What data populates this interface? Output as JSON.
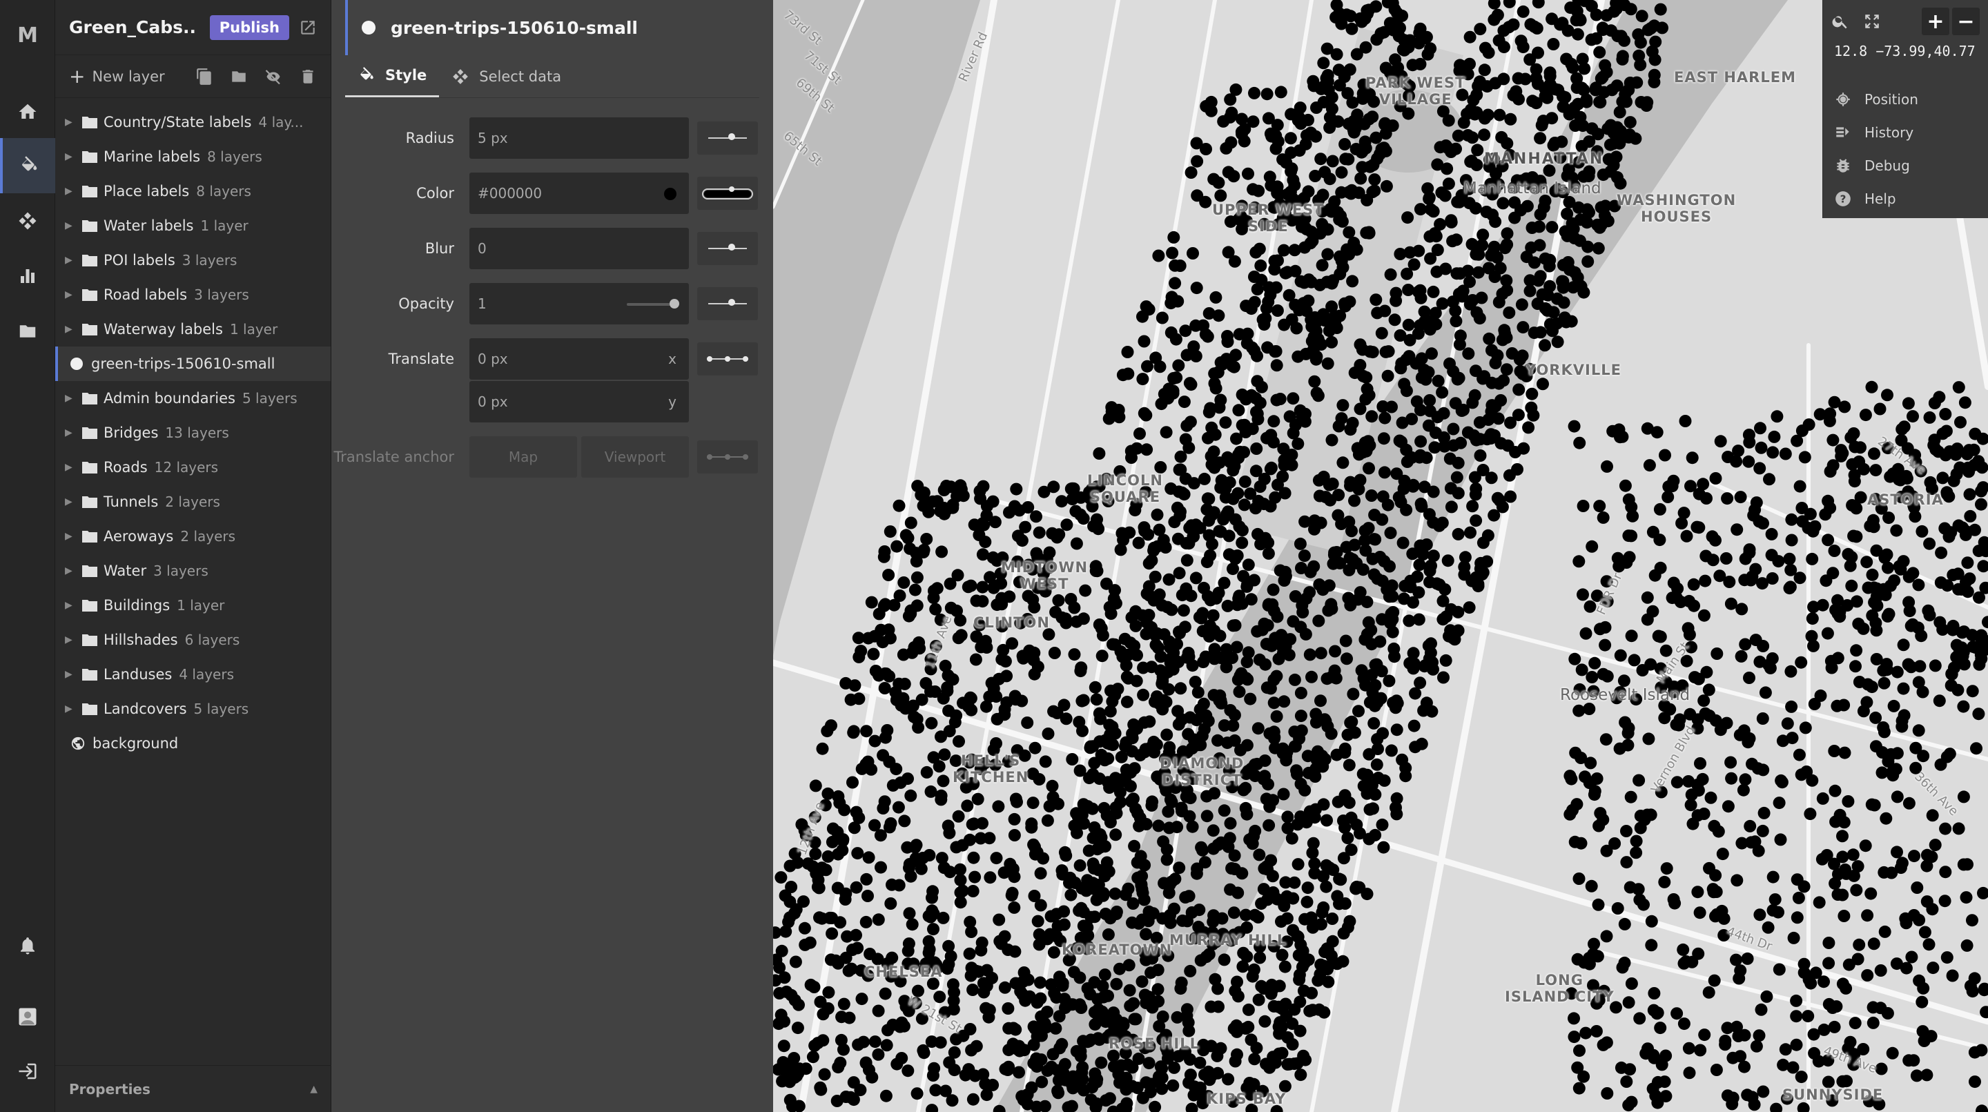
{
  "rail": {
    "logo": "M"
  },
  "project": {
    "title": "Green_Cabs...",
    "publish_label": "Publish"
  },
  "layers_panel": {
    "new_layer_label": "New layer",
    "items": [
      {
        "name": "Country/State labels",
        "count": "4 lay..."
      },
      {
        "name": "Marine labels",
        "count": "8 layers"
      },
      {
        "name": "Place labels",
        "count": "8 layers"
      },
      {
        "name": "Water labels",
        "count": "1 layer"
      },
      {
        "name": "POI labels",
        "count": "3 layers"
      },
      {
        "name": "Road labels",
        "count": "3 layers"
      },
      {
        "name": "Waterway labels",
        "count": "1 layer"
      },
      {
        "name": "green-trips-150610-small",
        "count": ""
      },
      {
        "name": "Admin boundaries",
        "count": "5 layers"
      },
      {
        "name": "Bridges",
        "count": "13 layers"
      },
      {
        "name": "Roads",
        "count": "12 layers"
      },
      {
        "name": "Tunnels",
        "count": "2 layers"
      },
      {
        "name": "Aeroways",
        "count": "2 layers"
      },
      {
        "name": "Water",
        "count": "3 layers"
      },
      {
        "name": "Buildings",
        "count": "1 layer"
      },
      {
        "name": "Hillshades",
        "count": "6 layers"
      },
      {
        "name": "Landuses",
        "count": "4 layers"
      },
      {
        "name": "Landcovers",
        "count": "5 layers"
      },
      {
        "name": "background",
        "count": ""
      }
    ],
    "properties_label": "Properties"
  },
  "editor": {
    "layer_title": "green-trips-150610-small",
    "tabs": {
      "style": "Style",
      "select_data": "Select data"
    },
    "radius": {
      "label": "Radius",
      "value": "5 px"
    },
    "color": {
      "label": "Color",
      "value": "#000000",
      "swatch": "#000000"
    },
    "blur": {
      "label": "Blur",
      "value": "0"
    },
    "opacity": {
      "label": "Opacity",
      "value": "1",
      "level": 1
    },
    "translate": {
      "label": "Translate",
      "x_value": "0 px",
      "x_axis": "x",
      "y_value": "0 px",
      "y_axis": "y"
    },
    "translate_anchor": {
      "label": "Translate anchor",
      "opt_map": "Map",
      "opt_viewport": "Viewport"
    }
  },
  "map": {
    "labels": {
      "manhattan": "MANHATTAN",
      "manhattan_island": "Manhattan Island",
      "park_west_village": "PARK WEST\nVILLAGE",
      "east_harlem": "EAST HARLEM",
      "washington_houses": "WASHINGTON\nHOUSES",
      "upper_west_side": "UPPER WEST\nSIDE",
      "yorkville": "YORKVILLE",
      "lincoln_square": "LINCOLN\nSQUARE",
      "midtown_west": "MIDTOWN\nWEST",
      "clinton": "CLINTON",
      "hells_kitchen": "HELL'S\nKITCHEN",
      "diamond_district": "DIAMOND\nDISTRICT",
      "roosevelt_island": "Roosevelt Island",
      "astoria": "ASTORIA",
      "chelsea": "CHELSEA",
      "koreatown": "KOREATOWN",
      "murray_hill": "MURRAY HILL",
      "long_island_city": "LONG\nISLAND CITY",
      "rose_hill": "ROSE HILL",
      "kips_bay": "KIPS BAY",
      "sunnyside": "SUNNYSIDE",
      "st_73rd": "73rd St",
      "st_71st": "71st St",
      "st_69th": "69th St",
      "st_65th": "65th St",
      "river_rd": "River Rd",
      "fdr_dr": "FDR Dr",
      "broadway": "Broadway",
      "main_st": "Main St",
      "st_27th": "27th Ave",
      "ave_12th": "12th Ave",
      "ave_11th": "11th Ave",
      "vernon_blvd": "Vernon Blvd",
      "st_21st": "W 21st St",
      "dr_44th": "44th Dr",
      "ave_49th": "49th Ave",
      "ave_36th": "36th Ave"
    },
    "colors": {
      "land": "#dcdcdc",
      "water": "#bdbdbd",
      "park": "#cfcfcf",
      "road": "#f7f7f7",
      "points": "#000000"
    }
  },
  "controls": {
    "zoom_in": "+",
    "zoom_out": "−",
    "coords": "12.8 −73.99,40.77",
    "position": "Position",
    "history": "History",
    "debug": "Debug",
    "help": "Help"
  }
}
